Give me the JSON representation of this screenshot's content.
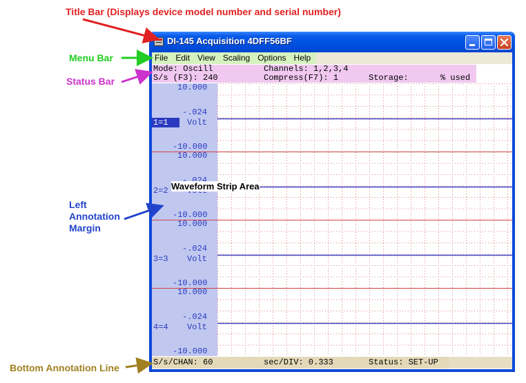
{
  "callouts": {
    "title_bar": "Title Bar (Displays device model number and serial number)",
    "menu_bar": "Menu Bar",
    "status_bar": "Status Bar",
    "left_margin_line1": "Left",
    "left_margin_line2": "Annotation",
    "left_margin_line3": "Margin",
    "waveform_area": "Waveform Strip Area",
    "bottom_line": "Bottom Annotation Line",
    "colors": {
      "title": "#e02020",
      "menu": "#22cc22",
      "status": "#cc33cc",
      "margin": "#2244cc",
      "bottom": "#a08020"
    }
  },
  "window": {
    "title": "DI-145 Acquisition 4DFF56BF",
    "icon": "app-icon",
    "controls": {
      "minimize": "minimize-icon",
      "maximize": "maximize-icon",
      "close": "close-icon"
    }
  },
  "menu": [
    "File",
    "Edit",
    "View",
    "Scaling",
    "Options",
    "Help"
  ],
  "status": {
    "mode": "Mode: Oscill",
    "channels": "Channels: 1,2,3,4",
    "sample_rate": "S/s (F3): 240",
    "compress": "Compress(F7): 1",
    "storage": "Storage:",
    "used": "% used"
  },
  "channels": [
    {
      "top": "10.000",
      "mid": "-.024",
      "label": "1=1",
      "unit": "Volt",
      "bottom": "-10.000",
      "selected": true
    },
    {
      "top": "10.000",
      "mid": "-.024",
      "label": "2=2",
      "unit": "Volt",
      "bottom": "-10.000",
      "selected": false
    },
    {
      "top": "10.000",
      "mid": "-.024",
      "label": "3=3",
      "unit": "Volt",
      "bottom": "-10.000",
      "selected": false
    },
    {
      "top": "10.000",
      "mid": "-.024",
      "label": "4=4",
      "unit": "Volt",
      "bottom": "-10.000",
      "selected": false
    }
  ],
  "bottom_annotation": {
    "samples_per_chan": "S/s/CHAN: 60",
    "sec_per_div": "sec/DIV: 0.333",
    "status": "Status: SET-UP"
  },
  "colors": {
    "trace": "#4040c0",
    "strip_divider": "#d04040",
    "grid": "#e08080",
    "margin_bg": "#c0c8f0",
    "status_bg": "#f0c8f0"
  }
}
